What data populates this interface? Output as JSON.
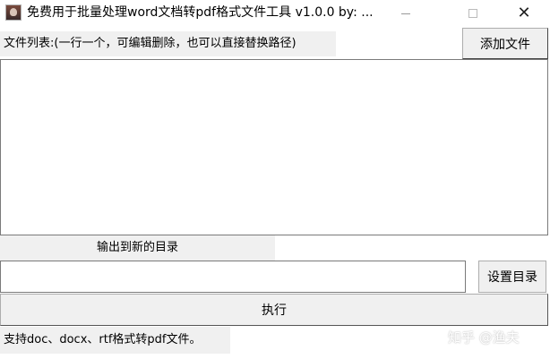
{
  "window": {
    "title": "免费用于批量处理word文档转pdf格式文件工具 v1.0.0    by: ...",
    "icon": "app-icon",
    "controls": {
      "minimize": "minimize-icon",
      "maximize": "maximize-icon",
      "close": "close-icon",
      "close_glyph": "✕"
    }
  },
  "file_list": {
    "label": "文件列表:(一行一个，可编辑删除，也可以直接替换路径)",
    "add_button": "添加文件",
    "content": ""
  },
  "output": {
    "label": "输出到新的目录",
    "path_value": "",
    "set_dir_button": "设置目录"
  },
  "execute_button": "执行",
  "status_text": "支持doc、docx、rtf格式转pdf文件。",
  "watermark": "知乎 @渔夫"
}
